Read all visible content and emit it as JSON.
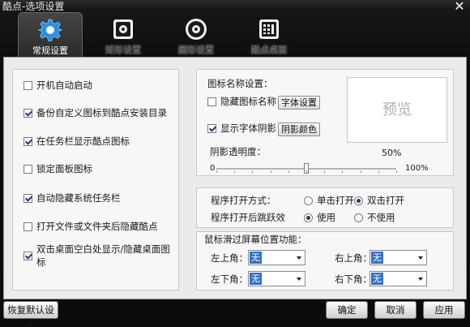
{
  "window": {
    "title": "酷点-选项设置",
    "close_label": "✕"
  },
  "tabs": [
    {
      "label": "常规设置",
      "icon": "gear-icon",
      "active": true
    },
    {
      "label": "矩形设置",
      "icon": "square-gear-icon",
      "active": false
    },
    {
      "label": "圆形设置",
      "icon": "circle-gear-icon",
      "active": false
    },
    {
      "label": "酷点桌面",
      "icon": "desktop-grid-icon",
      "active": false
    }
  ],
  "general": {
    "checkboxes": [
      {
        "label": "开机自动启动",
        "checked": false
      },
      {
        "label": "备份自定义图标到酷点安装目录",
        "checked": true
      },
      {
        "label": "在任务栏显示酷点图标",
        "checked": true
      },
      {
        "label": "锁定面板图标",
        "checked": false
      },
      {
        "label": "自动隐藏系统任务栏",
        "checked": true
      },
      {
        "label": "打开文件或文件夹后隐藏酷点",
        "checked": false
      },
      {
        "label": "双击桌面空白处显示/隐藏桌面图标",
        "checked": true
      }
    ]
  },
  "icon_name": {
    "heading": "图标名称设置：",
    "hide_label": "隐藏图标名称",
    "hide_checked": false,
    "font_button": "字体设置",
    "shadow_label": "显示字体阴影",
    "shadow_checked": true,
    "shadow_color_button": "阴影颜色",
    "preview_text": "预览",
    "opacity_label": "阴影透明度：",
    "opacity_value": "50%",
    "opacity_fraction": 0.5,
    "slider_min": "0",
    "slider_max": "100%"
  },
  "program": {
    "open_mode_label": "程序打开方式：",
    "single_click": "单击打开",
    "double_click": "双击打开",
    "open_mode": "double",
    "jump_label": "程序打开后跳跃效",
    "use": "使用",
    "not_use": "不使用",
    "jump_mode": "use"
  },
  "corners": {
    "heading": "鼠标滑过屏幕位置功能：",
    "top_left_label": "左上角：",
    "top_right_label": "右上角：",
    "bottom_left_label": "左下角：",
    "bottom_right_label": "右下角：",
    "top_left_value": "无",
    "top_right_value": "无",
    "bottom_left_value": "无",
    "bottom_right_value": "无"
  },
  "footer": {
    "reset": "恢复默认设置",
    "ok": "确定",
    "cancel": "取消",
    "apply": "应用"
  }
}
